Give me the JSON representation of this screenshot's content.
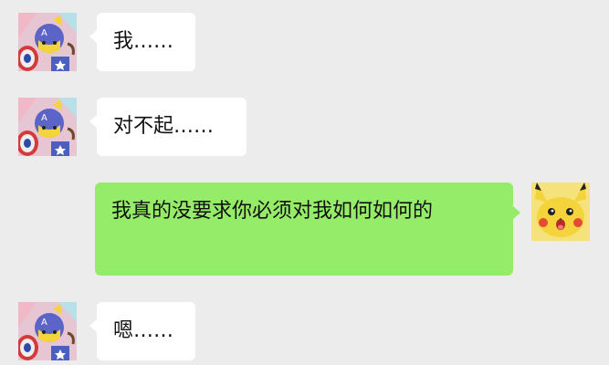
{
  "conversation": {
    "messages": [
      {
        "sender": "other",
        "avatar_icon": "pikachu-captain-avatar-icon",
        "text": "我……"
      },
      {
        "sender": "other",
        "avatar_icon": "pikachu-captain-avatar-icon",
        "text": "对不起……"
      },
      {
        "sender": "self",
        "avatar_icon": "pikachu-avatar-icon",
        "text": "我真的没要求你必须对我如何如何的"
      },
      {
        "sender": "other",
        "avatar_icon": "pikachu-captain-avatar-icon",
        "text": "嗯……"
      }
    ]
  },
  "colors": {
    "background": "#ececec",
    "other_bubble": "#ffffff",
    "self_bubble": "#95ec69",
    "text": "#111111"
  }
}
